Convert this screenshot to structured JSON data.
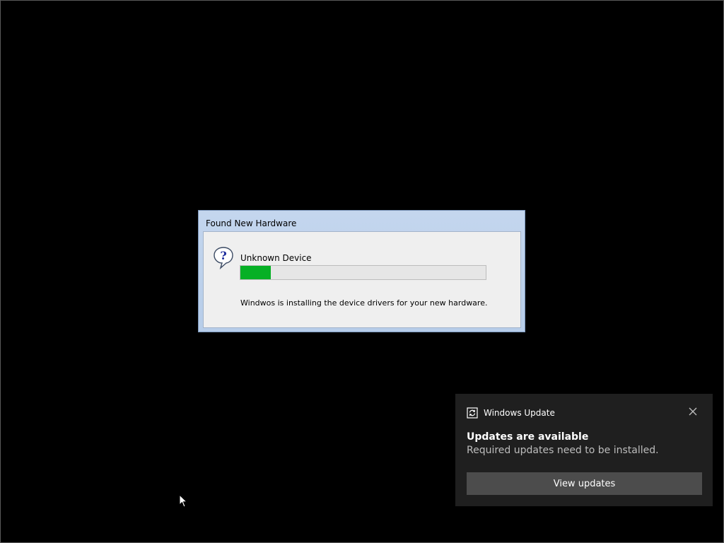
{
  "dialog": {
    "title": "Found New Hardware",
    "device_name": "Unknown Device",
    "progress": 0.125,
    "message": "Windwos is installing the device drivers for your new hardware.",
    "icon": "question-icon"
  },
  "toast": {
    "app_name": "Windows Update",
    "app_icon": "update-icon",
    "title": "Updates are available",
    "message": "Required updates need to be installed.",
    "button_label": "View updates",
    "close_icon": "close-icon"
  },
  "colors": {
    "desktop": "#000000",
    "progress_fill": "#06b025",
    "toast_bg": "#1f1f1f",
    "toast_button": "#4c4c4c"
  }
}
